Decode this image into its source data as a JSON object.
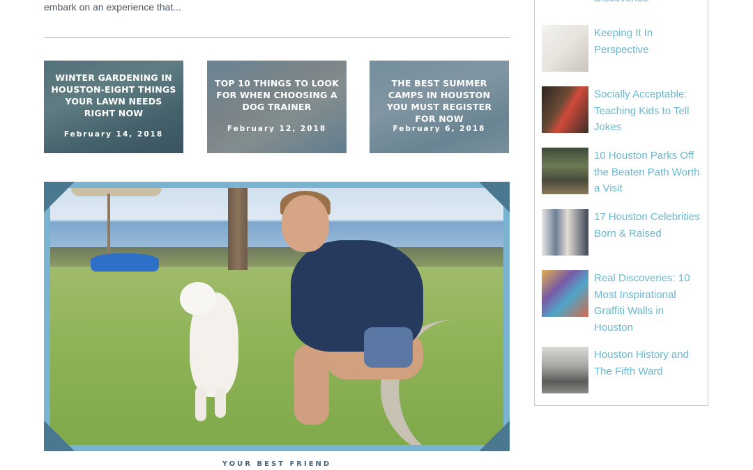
{
  "intro": {
    "text": "embark on an experience that..."
  },
  "related_posts": [
    {
      "title": "WINTER GARDENING IN HOUSTON-EIGHT THINGS YOUR LAWN NEEDS RIGHT NOW",
      "date": "February 14, 2018"
    },
    {
      "title": "TOP 10 THINGS TO LOOK FOR WHEN CHOOSING A DOG TRAINER",
      "date": "February 12, 2018"
    },
    {
      "title": "THE BEST SUMMER CAMPS IN HOUSTON YOU MUST REGISTER FOR NOW",
      "date": "February 6, 2018"
    }
  ],
  "feature": {
    "caption": "YOUR BEST FRIEND"
  },
  "sidebar": {
    "items": [
      {
        "label": "Discoveries"
      },
      {
        "label": "Keeping It In Perspective"
      },
      {
        "label": "Socially Acceptable: Teaching Kids to Tell Jokes"
      },
      {
        "label": "10 Houston Parks Off the Beaten Path Worth a Visit"
      },
      {
        "label": "17 Houston Celebrities Born & Raised"
      },
      {
        "label": "Real Discoveries: 10 Most Inspirational Graffiti Walls in Houston"
      },
      {
        "label": "Houston History and The Fifth Ward"
      }
    ]
  },
  "colors": {
    "link": "#6ab7cf",
    "frame": "#7ab3d0",
    "frame_corner": "#4b7891"
  }
}
